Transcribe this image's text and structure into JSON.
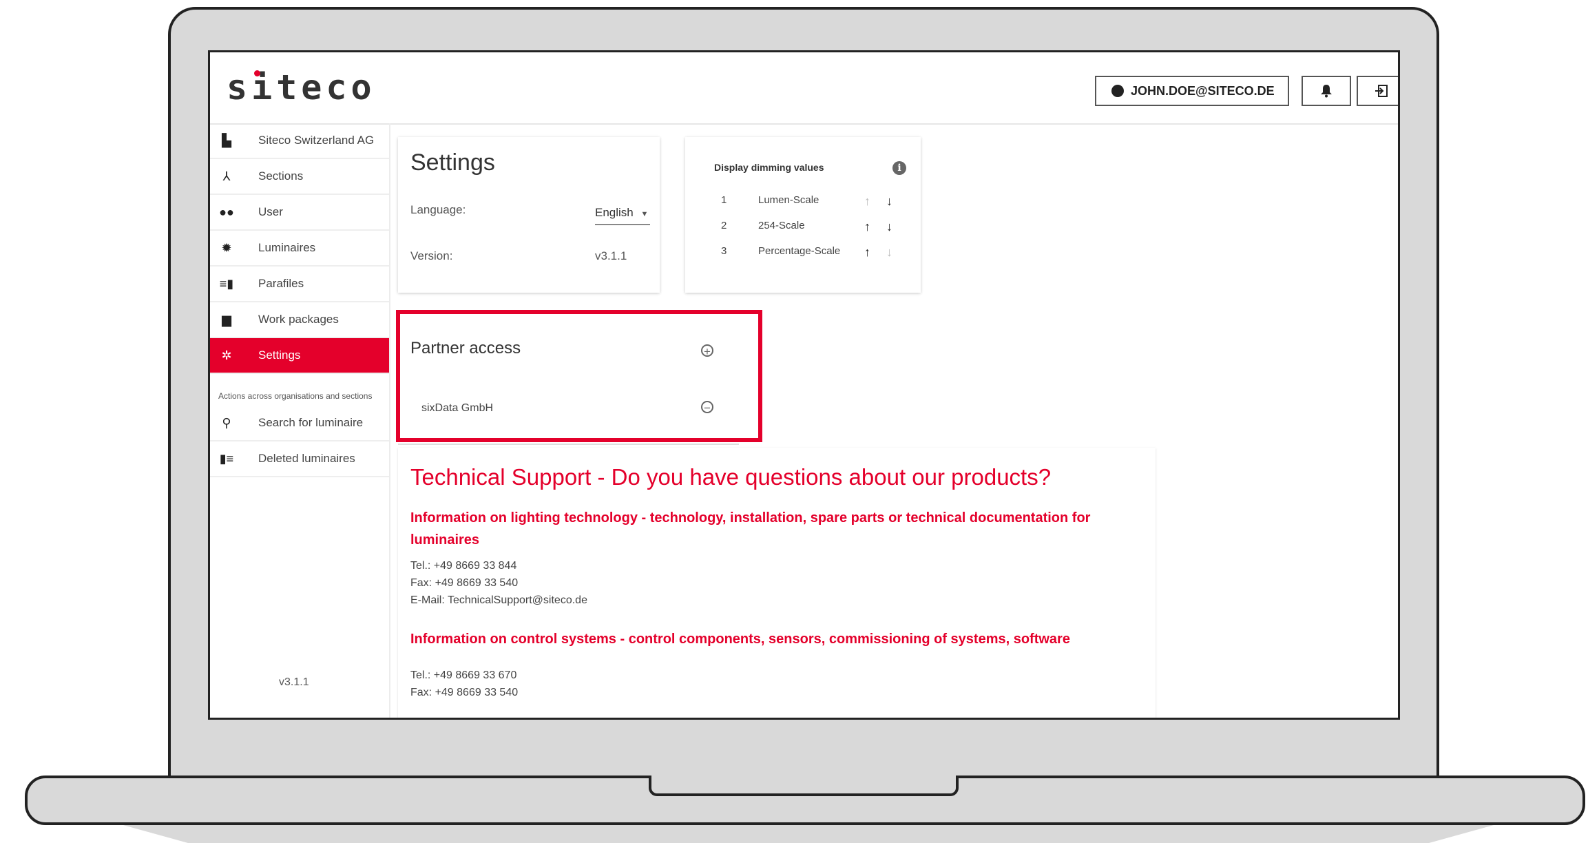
{
  "header": {
    "logo": "siteco",
    "user_email": "JOHN.DOE@SITECO.DE"
  },
  "sidebar": {
    "items": [
      {
        "label": "Siteco Switzerland AG",
        "icon": "building-icon"
      },
      {
        "label": "Sections",
        "icon": "hierarchy-icon"
      },
      {
        "label": "User",
        "icon": "users-icon"
      },
      {
        "label": "Luminaires",
        "icon": "lamp-icon"
      },
      {
        "label": "Parafiles",
        "icon": "parafile-icon"
      },
      {
        "label": "Work packages",
        "icon": "briefcase-icon"
      },
      {
        "label": "Settings",
        "icon": "gear-icon",
        "active": true
      }
    ],
    "section_note": "Actions across organisations and sections",
    "actions": [
      {
        "label": "Search for luminaire",
        "icon": "search-icon"
      },
      {
        "label": "Deleted luminaires",
        "icon": "trash-icon"
      }
    ],
    "version": "v3.1.1"
  },
  "settings": {
    "title": "Settings",
    "language_label": "Language:",
    "language_value": "English",
    "version_label": "Version:",
    "version_value": "v3.1.1"
  },
  "dimming": {
    "title": "Display dimming values",
    "rows": [
      {
        "num": "1",
        "name": "Lumen-Scale"
      },
      {
        "num": "2",
        "name": "254-Scale"
      },
      {
        "num": "3",
        "name": "Percentage-Scale"
      }
    ]
  },
  "partner": {
    "title": "Partner access",
    "entries": [
      "sixData GmbH"
    ]
  },
  "support": {
    "title": "Technical Support - Do you have questions about our products?",
    "lighting_heading": "Information on lighting technology - technology, installation, spare parts or technical documentation for luminaires",
    "lighting_tel": "Tel.: +49 8669 33 844",
    "lighting_fax": "Fax: +49 8669 33 540",
    "lighting_email": "E-Mail: TechnicalSupport@siteco.de",
    "control_heading": "Information on control systems - control components, sensors, commissioning of systems, software",
    "control_tel": "Tel.: +49 8669 33 670",
    "control_fax": "Fax: +49 8669 33 540"
  },
  "colors": {
    "accent": "#e4002b"
  }
}
